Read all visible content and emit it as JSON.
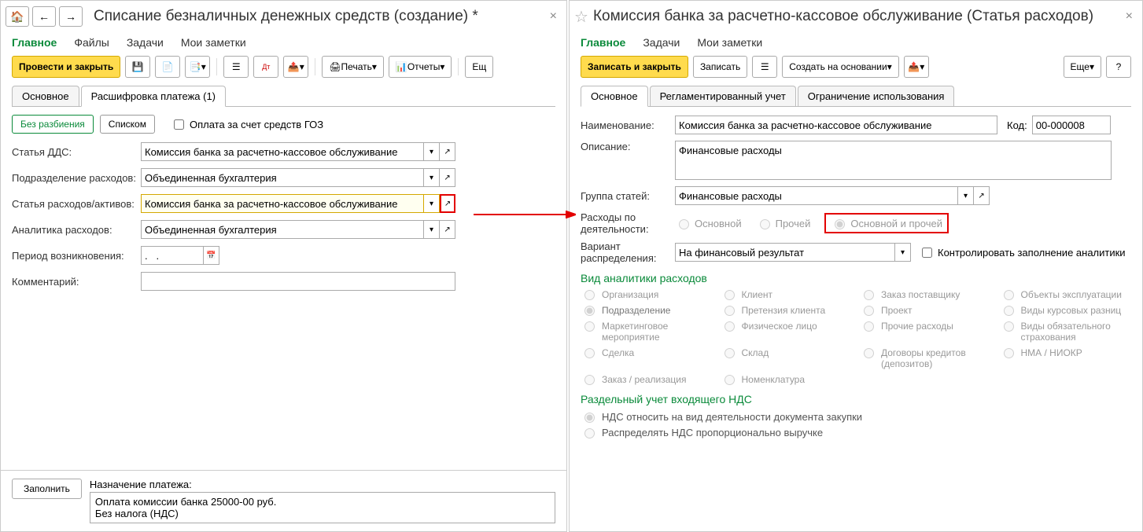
{
  "left": {
    "title": "Списание безналичных денежных средств (создание) *",
    "main_tabs": [
      "Главное",
      "Файлы",
      "Задачи",
      "Мои заметки"
    ],
    "toolbar": {
      "post_close": "Провести и закрыть",
      "print": "Печать",
      "reports": "Отчеты",
      "more": "Ещ"
    },
    "sub_tabs": [
      "Основное",
      "Расшифровка платежа (1)"
    ],
    "mode": {
      "no_split": "Без разбиения",
      "list": "Списком",
      "goz": "Оплата за счет средств ГОЗ"
    },
    "fields": {
      "dds_label": "Статья ДДС:",
      "dds_value": "Комиссия банка за расчетно-кассовое обслуживание",
      "dept_label": "Подразделение расходов:",
      "dept_value": "Объединенная бухгалтерия",
      "expense_label": "Статья расходов/активов:",
      "expense_value": "Комиссия банка за расчетно-кассовое обслуживание",
      "analytics_label": "Аналитика расходов:",
      "analytics_value": "Объединенная бухгалтерия",
      "period_label": "Период возникновения:",
      "period_value": ".   .",
      "comment_label": "Комментарий:",
      "comment_value": ""
    },
    "bottom": {
      "fill": "Заполнить",
      "purpose_label": "Назначение платежа:",
      "purpose_line1": "Оплата комиссии банка 25000-00 руб.",
      "purpose_line2": "Без налога (НДС)"
    }
  },
  "right": {
    "title": "Комиссия банка за расчетно-кассовое обслуживание (Статья расходов)",
    "main_tabs": [
      "Главное",
      "Задачи",
      "Мои заметки"
    ],
    "toolbar": {
      "save_close": "Записать и закрыть",
      "save": "Записать",
      "create_based": "Создать на основании",
      "more": "Еще"
    },
    "sub_tabs": [
      "Основное",
      "Регламентированный учет",
      "Ограничение использования"
    ],
    "fields": {
      "name_label": "Наименование:",
      "name_value": "Комиссия банка за расчетно-кассовое обслуживание",
      "code_label": "Код:",
      "code_value": "00-000008",
      "desc_label": "Описание:",
      "desc_value": "Финансовые расходы",
      "group_label": "Группа статей:",
      "group_value": "Финансовые расходы",
      "activity_label": "Расходы по деятельности:",
      "activity_main": "Основной",
      "activity_other": "Прочей",
      "activity_both": "Основной и прочей",
      "variant_label": "Вариант распределения:",
      "variant_value": "На финансовый результат",
      "control_check": "Контролировать заполнение аналитики"
    },
    "analytics_title": "Вид аналитики расходов",
    "analytics_options": [
      [
        "Организация",
        "Клиент",
        "Заказ поставщику",
        "Объекты эксплуатации"
      ],
      [
        "Подразделение",
        "Претензия клиента",
        "Проект",
        "Виды курсовых разниц"
      ],
      [
        "Маркетинговое мероприятие",
        "Физическое лицо",
        "Прочие расходы",
        "Виды обязательного страхования"
      ],
      [
        "Сделка",
        "Склад",
        "Договоры кредитов (депозитов)",
        "НМА / НИОКР"
      ],
      [
        "Заказ / реализация",
        "Номенклатура",
        "",
        ""
      ]
    ],
    "vat_title": "Раздельный учет входящего НДС",
    "vat_opt1": "НДС относить на вид деятельности документа закупки",
    "vat_opt2": "Распределять НДС пропорционально выручке"
  }
}
